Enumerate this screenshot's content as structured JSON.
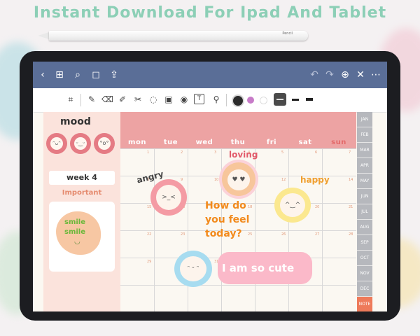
{
  "banner": "Instant Download For Ipad And Tablet",
  "pencil_brand": "Pencil",
  "navbar": {
    "back": "‹",
    "grid": "⊞",
    "search": "⌕",
    "bookmark": "◻",
    "share": "⇪",
    "undo": "↶",
    "redo": "↷",
    "add": "⊕",
    "close": "✕",
    "more": "⋯"
  },
  "toolbar": {
    "tools": [
      "⌗",
      "✎",
      "⌫",
      "✐",
      "✂",
      "◌",
      "▣",
      "◉",
      "T",
      "⚲"
    ],
    "colors": [
      "#2b2b2b",
      "#c77bc8",
      "#ffffff"
    ]
  },
  "sidebar": {
    "mood_title": "mood",
    "week_label": "week 4",
    "important_label": "Important",
    "smile_line1": "smile",
    "smile_line2": "smile"
  },
  "calendar": {
    "days": [
      "mon",
      "tue",
      "wed",
      "thu",
      "fri",
      "sat",
      "sun"
    ],
    "header_color": "#eda3a3"
  },
  "months": [
    "JAN",
    "FEB",
    "MAR",
    "APR",
    "MAY",
    "JUN",
    "JUL",
    "AUG",
    "SEP",
    "OCT",
    "NOV",
    "DEC",
    "NOTE"
  ],
  "annotations": {
    "loving": "loving",
    "angry": "angry",
    "happy": "happy",
    "question": "How do you feel today?",
    "question_l1": "How do",
    "question_l2": "you feel",
    "question_l3": "today?",
    "cute": "I am so cute"
  }
}
